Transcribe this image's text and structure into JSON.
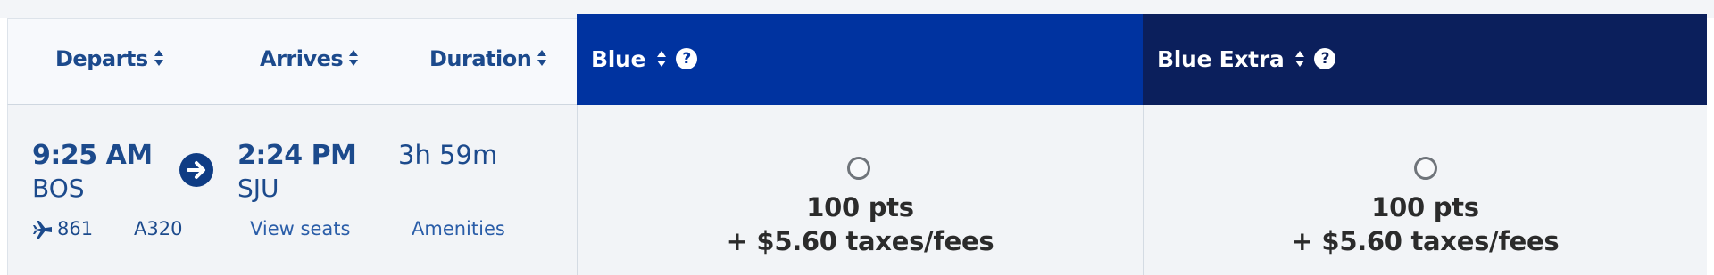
{
  "header": {
    "departs": "Departs",
    "arrives": "Arrives",
    "duration": "Duration"
  },
  "fares": [
    {
      "name": "Blue",
      "color": "#0033a0"
    },
    {
      "name": "Blue Extra",
      "color": "#0b1f5c"
    }
  ],
  "flight": {
    "depart_time": "9:25 AM",
    "depart_airport": "BOS",
    "arrive_time": "2:24 PM",
    "arrive_airport": "SJU",
    "duration": "3h 59m",
    "flight_number": "861",
    "aircraft": "A320",
    "view_seats": "View seats",
    "amenities": "Amenities"
  },
  "prices": [
    {
      "points": "100 pts",
      "taxes": "+ $5.60 taxes/fees"
    },
    {
      "points": "100 pts",
      "taxes": "+ $5.60 taxes/fees"
    }
  ],
  "colors": {
    "text_blue": "#1c4a8c",
    "link_blue": "#2a5da8",
    "row_bg": "#f2f4f7"
  }
}
